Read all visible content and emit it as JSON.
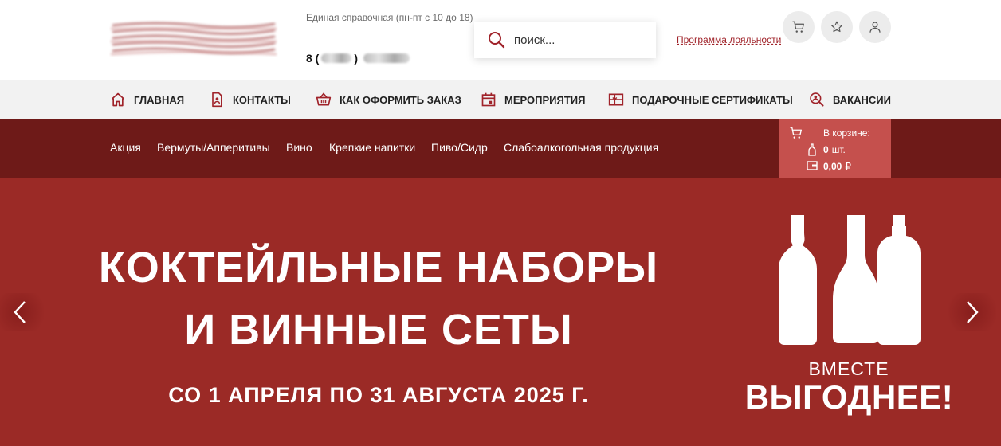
{
  "header": {
    "hotline_label": "Единая справочная (пн-пт с 10 до 18)",
    "phone_prefix": "8 (",
    "phone_mid": ")",
    "search_placeholder": "поиск...",
    "loyalty_link": "Программа лояльности",
    "icons": [
      "cart-icon",
      "star-icon",
      "user-icon"
    ]
  },
  "main_nav": [
    {
      "label": "ГЛАВНАЯ",
      "icon": "home-icon"
    },
    {
      "label": "КОНТАКТЫ",
      "icon": "contacts-icon"
    },
    {
      "label": "КАК ОФОРМИТЬ ЗАКАЗ",
      "icon": "basket-icon"
    },
    {
      "label": "МЕРОПРИЯТИЯ",
      "icon": "calendar-icon"
    },
    {
      "label": "ПОДАРОЧНЫЕ СЕРТИФИКАТЫ",
      "icon": "gift-card-icon"
    },
    {
      "label": "ВАКАНСИИ",
      "icon": "search-person-icon"
    }
  ],
  "categories": [
    "Акция",
    "Вермуты/Апперитивы",
    "Вино",
    "Крепкие напитки",
    "Пиво/Сидр",
    "Слабоалкогольная продукция"
  ],
  "cart_summary": {
    "title": "В корзине:",
    "count": "0",
    "count_unit": "шт.",
    "total": "0,00",
    "currency": "₽"
  },
  "banner": {
    "title_line1": "КОКТЕЙЛЬНЫЕ НАБОРЫ",
    "title_line2": "И ВИННЫЕ СЕТЫ",
    "dates": "СО 1 АПРЕЛЯ ПО 31 АВГУСТА 2025 Г.",
    "tagline1": "ВМЕСТЕ",
    "tagline2": "ВЫГОДНЕЕ!"
  },
  "colors": {
    "brand_red": "#9b2a26",
    "dark_red": "#6e1a18",
    "cart_box": "#c5504d",
    "nav_bg": "#f2f2f2"
  }
}
